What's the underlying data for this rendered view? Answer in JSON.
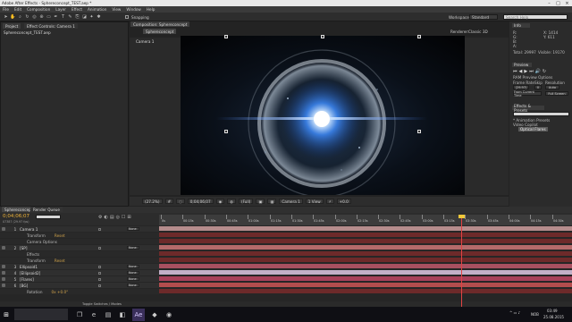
{
  "app": {
    "title": "Adobe After Effects - Sphereconcept_TEST.aep *"
  },
  "menu": [
    "File",
    "Edit",
    "Composition",
    "Layer",
    "Effect",
    "Animation",
    "View",
    "Window",
    "Help"
  ],
  "toolbar": {
    "snapping": "Snapping",
    "workspace_label": "Workspace:",
    "workspace_value": "Standard",
    "search_placeholder": "Search Help"
  },
  "project": {
    "tab": "Project",
    "item": "Sphereconcept_TEST.aep",
    "effect_tab": "Effect Controls: Camera 1"
  },
  "composition": {
    "tab": "Composition: Sphereconcept",
    "subtab": "Sphereconcept",
    "camera_label": "Camera 1",
    "renderer_label": "Renderer:",
    "renderer_value": "Classic 3D"
  },
  "viewer_bar": {
    "zoom": "(27.2%)",
    "timecode": "0;04;06;07",
    "quality": "(Full)",
    "view": "Camera 1",
    "views": "1 View",
    "exposure": "+0.0"
  },
  "info": {
    "r": "R:",
    "g": "G:",
    "b": "B:",
    "a": "A:",
    "x": "X: 1414",
    "y": "Y: 611",
    "total": "Total: 29997",
    "visible": "Visible: 19170"
  },
  "preview": {
    "tab": "Preview",
    "ram_label": "RAM Preview Options",
    "frame_rate_label": "Frame Rate",
    "skip_label": "Skip",
    "resolution_label": "Resolution",
    "frame_rate_value": "(29.97)",
    "skip_value": "0",
    "resolution_value": "Auto",
    "from_current": "From Current Time",
    "full_screen": "Full Screen"
  },
  "effects": {
    "tab": "Effects & Presets",
    "search_placeholder": "",
    "items": [
      "* Animation Presets",
      "Video Copilot",
      "Optical Flares"
    ]
  },
  "timeline": {
    "tab": "Sphereconcept",
    "render_queue": "Render Queue",
    "timecode": "0;04;06;07",
    "frames_label": "07387 (29.97 fps)",
    "ruler": [
      "0s",
      "00:15s",
      "00:30s",
      "00:45s",
      "01:00s",
      "01:15s",
      "01:30s",
      "01:45s",
      "02:00s",
      "02:15s",
      "02:30s",
      "02:45s",
      "03:00s",
      "03:15s",
      "03:30s",
      "03:45s",
      "04:00s",
      "04:15s",
      "04:30s"
    ],
    "layers": [
      {
        "num": "1",
        "name": "Camera 1",
        "parent": "None"
      },
      {
        "prop": "Transform",
        "value": "Reset"
      },
      {
        "prop": "Camera Options",
        "value": ""
      },
      {
        "num": "2",
        "name": "[SP]",
        "parent": "None"
      },
      {
        "prop": "Effects",
        "value": ""
      },
      {
        "prop": "Transform",
        "value": "Reset"
      },
      {
        "num": "3",
        "name": "Ellipsoid1",
        "parent": "None"
      },
      {
        "num": "4",
        "name": "[Ellipsoid2]",
        "parent": "None"
      },
      {
        "num": "5",
        "name": "[Flares]",
        "parent": "None"
      },
      {
        "num": "6",
        "name": "[BG]",
        "parent": "None"
      },
      {
        "prop": "Rotation",
        "value": "0x +0.0°"
      }
    ],
    "footer": "Toggle Switches / Modes"
  },
  "taskbar": {
    "time": "03:49",
    "date": "25.08.2015",
    "lang": "NOB"
  }
}
